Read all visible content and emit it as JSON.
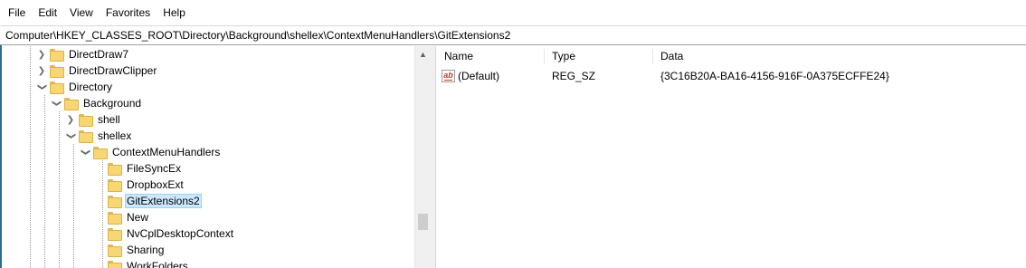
{
  "menu": {
    "items": [
      {
        "label": "File"
      },
      {
        "label": "Edit"
      },
      {
        "label": "View"
      },
      {
        "label": "Favorites"
      },
      {
        "label": "Help"
      }
    ]
  },
  "address": {
    "path": "Computer\\HKEY_CLASSES_ROOT\\Directory\\Background\\shellex\\ContextMenuHandlers\\GitExtensions2"
  },
  "tree": {
    "items": [
      {
        "label": "DirectDraw7",
        "expander": "collapsed"
      },
      {
        "label": "DirectDrawClipper",
        "expander": "collapsed"
      },
      {
        "label": "Directory",
        "expander": "expanded"
      },
      {
        "label": "Background",
        "expander": "expanded"
      },
      {
        "label": "shell",
        "expander": "collapsed"
      },
      {
        "label": "shellex",
        "expander": "expanded"
      },
      {
        "label": "ContextMenuHandlers",
        "expander": "expanded"
      },
      {
        "label": "FileSyncEx",
        "expander": "none"
      },
      {
        "label": "DropboxExt",
        "expander": "none"
      },
      {
        "label": "GitExtensions2",
        "expander": "none",
        "selected": true
      },
      {
        "label": "New",
        "expander": "none"
      },
      {
        "label": "NvCplDesktopContext",
        "expander": "none"
      },
      {
        "label": "Sharing",
        "expander": "none"
      },
      {
        "label": "WorkFolders",
        "expander": "none"
      }
    ]
  },
  "list": {
    "columns": [
      {
        "label": "Name"
      },
      {
        "label": "Type"
      },
      {
        "label": "Data"
      }
    ],
    "rows": [
      {
        "name": "(Default)",
        "type": "REG_SZ",
        "data": "{3C16B20A-BA16-4156-916F-0A375ECFFE24}",
        "icon": "string-value-icon"
      }
    ]
  },
  "colors": {
    "selection_bg": "#cce8ff",
    "selection_border": "#99d1ff",
    "folder": "#f7d774",
    "accent_left": "#2d6b8f"
  }
}
